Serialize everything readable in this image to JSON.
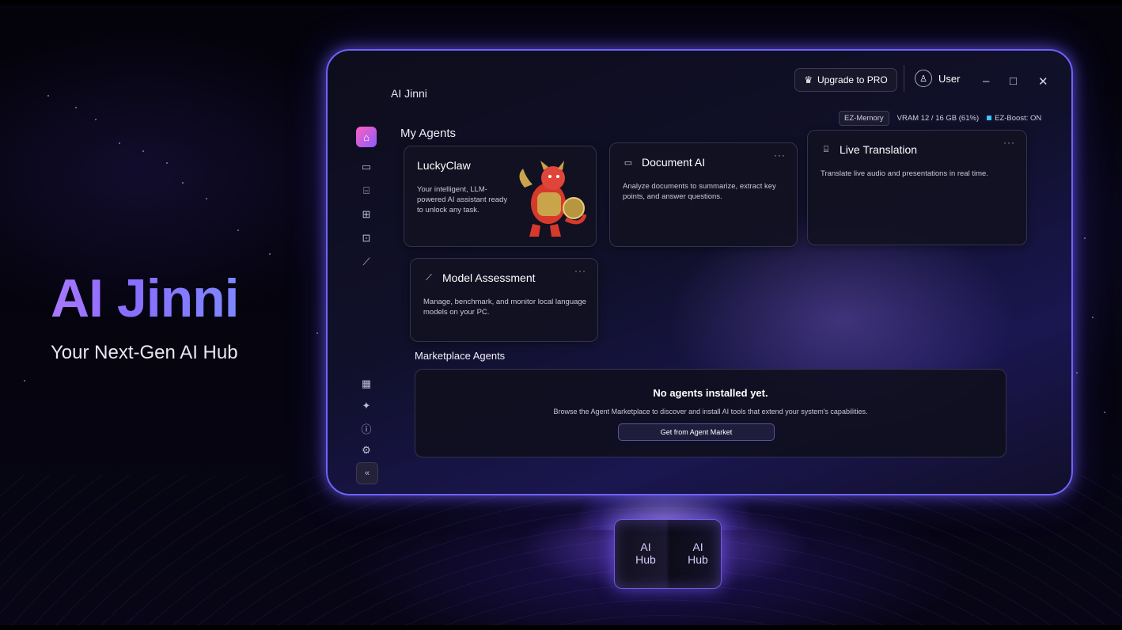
{
  "hero": {
    "title": "AI Jinni",
    "subtitle": "Your Next-Gen AI Hub"
  },
  "cube": {
    "face1": "AI\nHub",
    "face2": "AI\nHub"
  },
  "window": {
    "title": "AI Jinni",
    "upgrade_label": "Upgrade to PRO",
    "user_label": "User",
    "controls": {
      "minimize": "–",
      "maximize": "□",
      "close": "✕"
    }
  },
  "status": {
    "ez_memory": "EZ-Memory",
    "vram": "VRAM 12 / 16 GB (61%)",
    "ez_boost": "EZ-Boost: ON",
    "ez_boost_color": "#3ec6ff"
  },
  "sidebar": {
    "icons": [
      "home-icon",
      "document-icon",
      "translate-icon",
      "assessment-icon",
      "image-icon",
      "chart-icon"
    ],
    "bottom_icons": [
      "store-icon",
      "sparkle-icon",
      "info-icon",
      "settings-icon"
    ],
    "collapse_label": "«"
  },
  "my_agents": {
    "title": "My Agents",
    "cards": [
      {
        "title": "LuckyClaw",
        "desc": "Your intelligent, LLM-powered AI assistant ready to unlock any task."
      },
      {
        "title": "Document AI",
        "desc": "Analyze documents to summarize, extract key points, and answer questions.",
        "more": "···"
      },
      {
        "title": "Live Translation",
        "desc": "Translate live audio and presentations in real time.",
        "more": "···"
      },
      {
        "title": "Model Assessment",
        "desc": "Manage, benchmark, and monitor local language models on your PC.",
        "more": "···"
      }
    ]
  },
  "marketplace": {
    "title": "Marketplace Agents",
    "empty_title": "No agents installed yet.",
    "empty_desc": "Browse the Agent Marketplace to discover and install AI tools that extend your system's capabilities.",
    "button": "Get from Agent Market"
  },
  "colors": {
    "accent": "#6f63ff",
    "hero_gradient_start": "#a879ff",
    "hero_gradient_end": "#7d88ff"
  }
}
